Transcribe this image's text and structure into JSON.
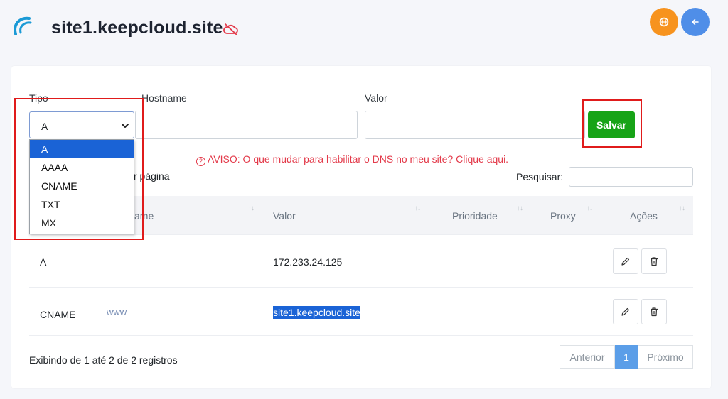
{
  "header": {
    "site_title": "site1.keepcloud.site",
    "cloud_icon": "cloud-off-icon",
    "globe_icon": "globe-icon",
    "back_icon": "arrow-left-icon"
  },
  "form": {
    "tipo_label": "Tipo",
    "hostname_label": "Hostname",
    "valor_label": "Valor",
    "tipo_value": "A",
    "save_label": "Salvar",
    "tipo_options": [
      "A",
      "AAAA",
      "CNAME",
      "TXT",
      "MX"
    ]
  },
  "warning": {
    "icon": "?",
    "text": "AVISO: O que mudar para habilitar o DNS no meu site? Clique aqui."
  },
  "table_controls": {
    "per_page_text": "r página",
    "search_label": "Pesquisar:"
  },
  "table": {
    "columns": [
      "ame",
      "Valor",
      "Prioridade",
      "Proxy",
      "Ações"
    ],
    "rows": [
      {
        "type": "A",
        "host": "",
        "value": "172.233.24.125"
      },
      {
        "type": "CNAME",
        "host": "www",
        "value": "site1.keepcloud.site"
      }
    ]
  },
  "footer": {
    "info": "Exibindo de 1 até 2 de 2 registros",
    "prev": "Anterior",
    "page": "1",
    "next": "Próximo"
  },
  "colors": {
    "save_green": "#17a317",
    "highlight_red": "#e01b1b",
    "globe_orange": "#f7931e",
    "back_blue": "#4f8ee8",
    "selection_blue": "#1a63d6"
  }
}
